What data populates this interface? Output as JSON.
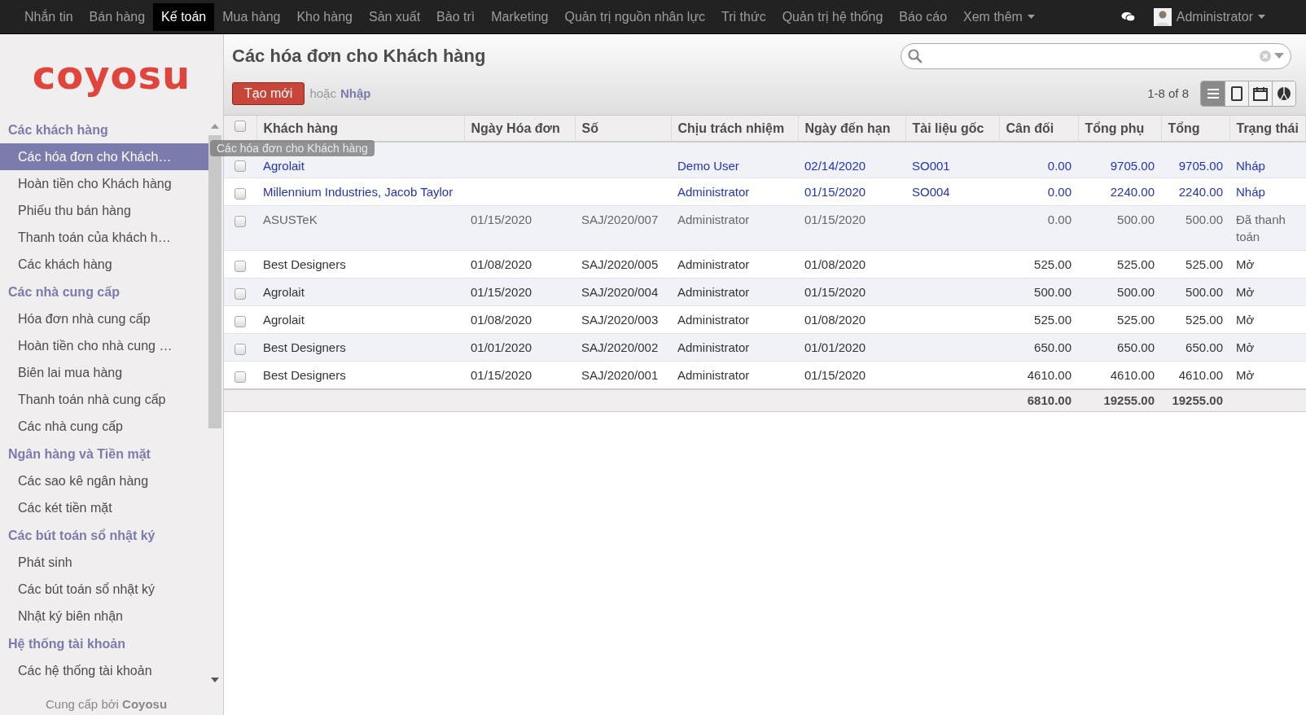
{
  "topbar": {
    "menus": [
      {
        "label": "Nhắn tin",
        "selected": false
      },
      {
        "label": "Bán hàng",
        "selected": false
      },
      {
        "label": "Kế toán",
        "selected": true
      },
      {
        "label": "Mua hàng",
        "selected": false
      },
      {
        "label": "Kho hàng",
        "selected": false
      },
      {
        "label": "Sản xuất",
        "selected": false
      },
      {
        "label": "Bảo trì",
        "selected": false
      },
      {
        "label": "Marketing",
        "selected": false
      },
      {
        "label": "Quản trị nguồn nhân lực",
        "selected": false
      },
      {
        "label": "Tri thức",
        "selected": false
      },
      {
        "label": "Quản trị hệ thống",
        "selected": false
      },
      {
        "label": "Báo cáo",
        "selected": false
      }
    ],
    "more": "Xem thêm",
    "user": "Administrator"
  },
  "sidebar": {
    "logo": "coyosu",
    "sections": [
      {
        "title": "Các khách hàng",
        "items": [
          {
            "label": "Các hóa đơn cho Khách…",
            "selected": true
          },
          {
            "label": "Hoàn tiền cho Khách hàng",
            "selected": false
          },
          {
            "label": "Phiếu thu bán hàng",
            "selected": false
          },
          {
            "label": "Thanh toán của khách h…",
            "selected": false
          },
          {
            "label": "Các khách hàng",
            "selected": false
          }
        ]
      },
      {
        "title": "Các nhà cung cấp",
        "items": [
          {
            "label": "Hóa đơn nhà cung cấp",
            "selected": false
          },
          {
            "label": "Hoàn tiền cho nhà cung …",
            "selected": false
          },
          {
            "label": "Biên lai mua hàng",
            "selected": false
          },
          {
            "label": "Thanh toán nhà cung cấp",
            "selected": false
          },
          {
            "label": "Các nhà cung cấp",
            "selected": false
          }
        ]
      },
      {
        "title": "Ngân hàng và Tiền mặt",
        "items": [
          {
            "label": "Các sao kê ngân hàng",
            "selected": false
          },
          {
            "label": "Các két tiền mặt",
            "selected": false
          }
        ]
      },
      {
        "title": "Các bút toán sổ nhật ký",
        "items": [
          {
            "label": "Phát sinh",
            "selected": false
          },
          {
            "label": "Các bút toán sổ nhật ký",
            "selected": false
          },
          {
            "label": "Nhật ký biên nhận",
            "selected": false
          }
        ]
      },
      {
        "title": "Hệ thống tài khoản",
        "items": [
          {
            "label": "Các hệ thống tài khoản",
            "selected": false
          }
        ]
      }
    ],
    "footer": "Cung cấp bởi **Coyosu**",
    "tooltip": "Các hóa đơn cho Khách hàng"
  },
  "page": {
    "title": "Các hóa đơn cho Khách hàng",
    "create_button": "Tạo mới",
    "or": "hoặc",
    "import_link": "Nhập",
    "pager": "1-8 of 8",
    "views": [
      {
        "kind": "list",
        "selected": true
      },
      {
        "kind": "form",
        "selected": false
      },
      {
        "kind": "calendar",
        "selected": false
      },
      {
        "kind": "graph",
        "selected": false
      }
    ]
  },
  "table": {
    "columns": [
      "Khách hàng",
      "Ngày Hóa đơn",
      "Số",
      "Chịu trách nhiệm",
      "Ngày đến hạn",
      "Tài liệu gốc",
      "Cân đối",
      "Tổng phụ",
      "Tổng",
      "Trạng thái"
    ],
    "rows": [
      {
        "kind": "draft",
        "checked": false,
        "cells": [
          "Agrolait",
          null,
          null,
          "Demo User",
          "02/14/2020",
          "SO001",
          "0.00",
          "9705.00",
          "9705.00",
          "Nháp"
        ]
      },
      {
        "kind": "draft",
        "checked": false,
        "cells": [
          "Millennium Industries, Jacob Taylor",
          null,
          null,
          "Administrator",
          "01/15/2020",
          "SO004",
          "0.00",
          "2240.00",
          "2240.00",
          "Nháp"
        ]
      },
      {
        "kind": "paid",
        "checked": false,
        "cells": [
          "ASUSTeK",
          "01/15/2020",
          "SAJ/2020/007",
          "Administrator",
          "01/15/2020",
          null,
          "0.00",
          "500.00",
          "500.00",
          "Đã thanh toán"
        ]
      },
      {
        "kind": "open",
        "checked": false,
        "cells": [
          "Best Designers",
          "01/08/2020",
          "SAJ/2020/005",
          "Administrator",
          "01/08/2020",
          null,
          "525.00",
          "525.00",
          "525.00",
          "Mở"
        ]
      },
      {
        "kind": "open",
        "checked": false,
        "cells": [
          "Agrolait",
          "01/15/2020",
          "SAJ/2020/004",
          "Administrator",
          "01/15/2020",
          null,
          "500.00",
          "500.00",
          "500.00",
          "Mở"
        ]
      },
      {
        "kind": "open",
        "checked": false,
        "cells": [
          "Agrolait",
          "01/08/2020",
          "SAJ/2020/003",
          "Administrator",
          "01/08/2020",
          null,
          "525.00",
          "525.00",
          "525.00",
          "Mở"
        ]
      },
      {
        "kind": "open",
        "checked": false,
        "cells": [
          "Best Designers",
          "01/01/2020",
          "SAJ/2020/002",
          "Administrator",
          "01/01/2020",
          null,
          "650.00",
          "650.00",
          "650.00",
          "Mở"
        ]
      },
      {
        "kind": "open",
        "checked": false,
        "cells": [
          "Best Designers",
          "01/15/2020",
          "SAJ/2020/001",
          "Administrator",
          "01/15/2020",
          null,
          "4610.00",
          "4610.00",
          "4610.00",
          "Mở"
        ]
      }
    ],
    "all_checked": false,
    "totals": {
      "balance": "6810.00",
      "subtotal": "19255.00",
      "total": "19255.00"
    }
  }
}
